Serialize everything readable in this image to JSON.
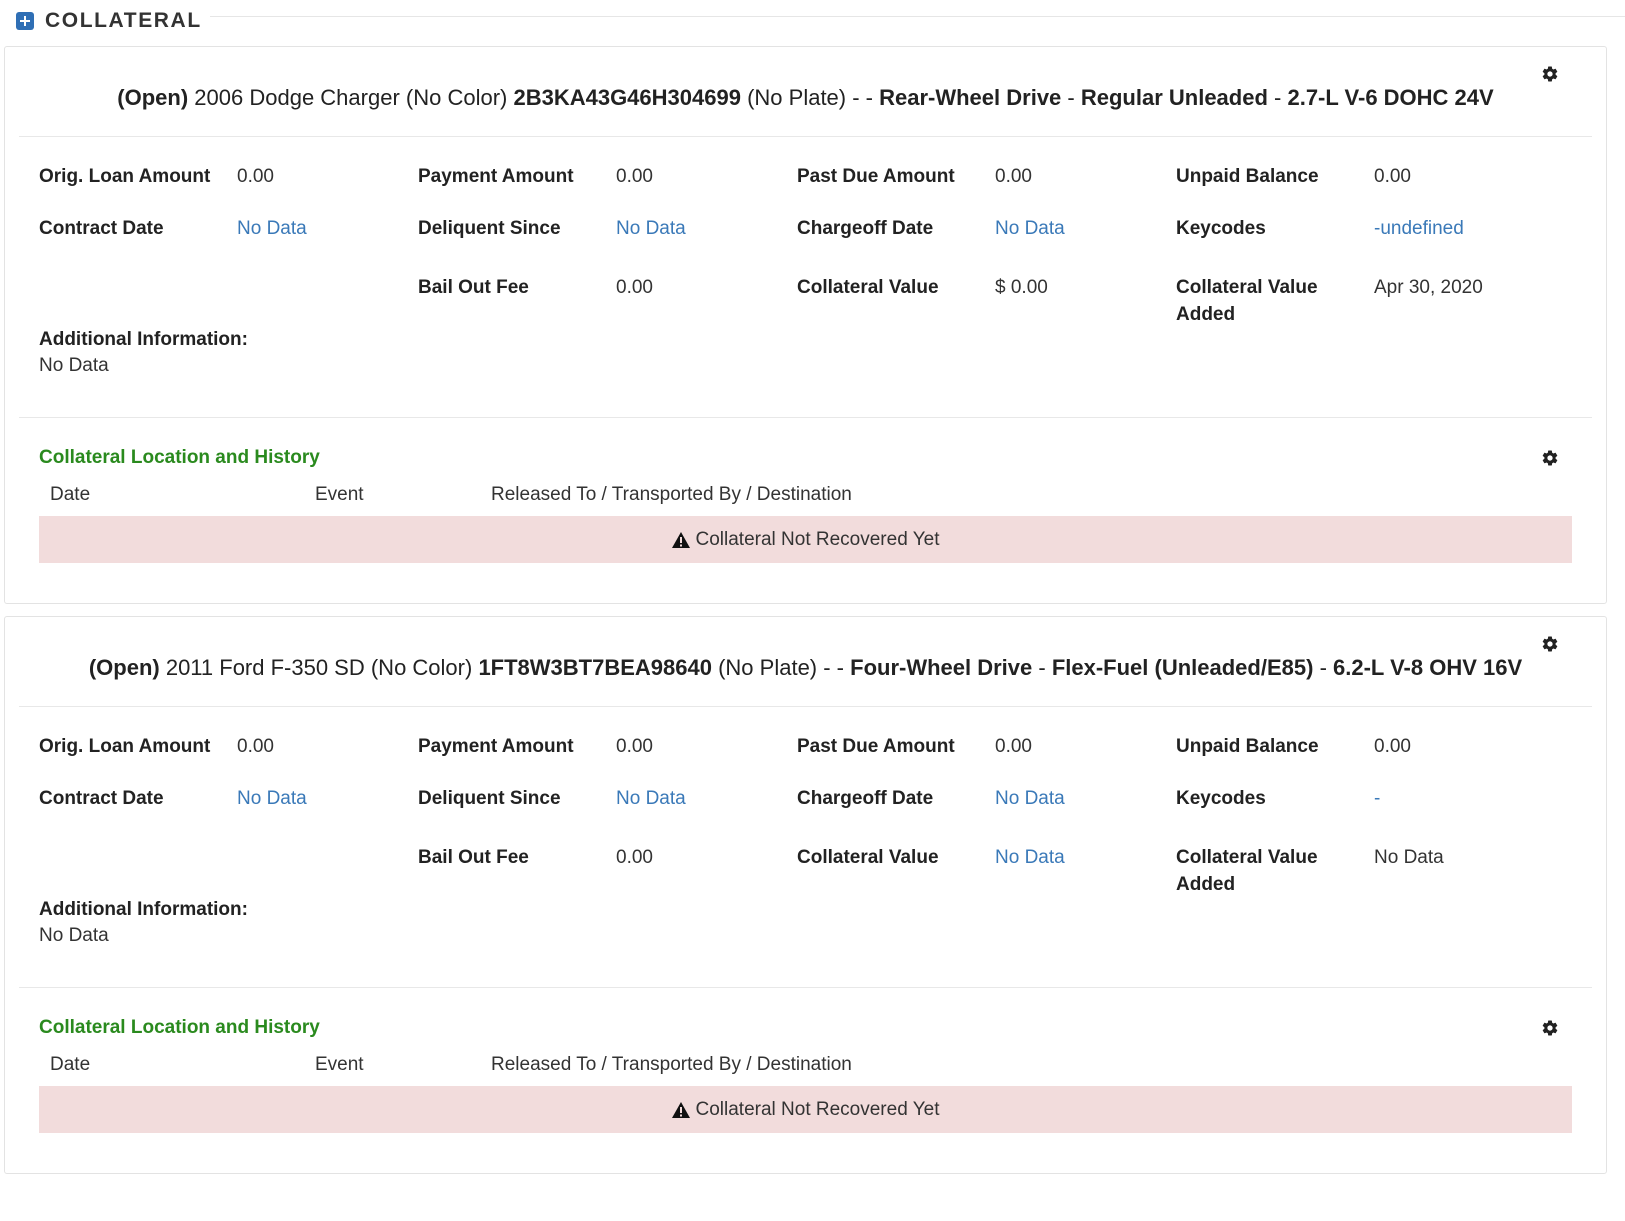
{
  "section": {
    "title": "COLLATERAL"
  },
  "collaterals": [
    {
      "title": {
        "status": "(Open)",
        "vehicle": " 2006 Dodge Charger (No Color) ",
        "vin": "2B3KA43G46H304699",
        "plate": " (No Plate) - - ",
        "drive": "Rear-Wheel Drive",
        "sep1": " - ",
        "fuel": "Regular Unleaded",
        "sep2": " - ",
        "engine": "2.7-L V-6 DOHC 24V"
      },
      "fields": {
        "orig_loan_amount": {
          "label": "Orig. Loan Amount",
          "value": "0.00"
        },
        "payment_amount": {
          "label": "Payment Amount",
          "value": "0.00"
        },
        "past_due_amount": {
          "label": "Past Due Amount",
          "value": "0.00"
        },
        "unpaid_balance": {
          "label": "Unpaid Balance",
          "value": "0.00"
        },
        "contract_date": {
          "label": "Contract Date",
          "value": "No Data"
        },
        "deliquent_since": {
          "label": "Deliquent Since",
          "value": "No Data"
        },
        "chargeoff_date": {
          "label": "Chargeoff Date",
          "value": "No Data"
        },
        "keycodes": {
          "label": "Keycodes",
          "value": "-undefined"
        },
        "bail_out_fee": {
          "label": "Bail Out Fee",
          "value": "0.00"
        },
        "collateral_value": {
          "label": "Collateral Value",
          "value": "$ 0.00"
        },
        "collateral_value_added": {
          "label": "Collateral Value Added",
          "value": "Apr 30, 2020"
        }
      },
      "additional_info": {
        "label": "Additional Information:",
        "value": "No Data"
      },
      "history": {
        "title": "Collateral Location and History",
        "columns": [
          "Date",
          "Event",
          "Released To / Transported By / Destination"
        ],
        "alert": "Collateral Not Recovered Yet"
      }
    },
    {
      "title": {
        "status": "(Open)",
        "vehicle": " 2011 Ford F-350 SD (No Color) ",
        "vin": "1FT8W3BT7BEA98640",
        "plate": " (No Plate) - - ",
        "drive": "Four-Wheel Drive",
        "sep1": " - ",
        "fuel": "Flex-Fuel (Unleaded/E85)",
        "sep2": " - ",
        "engine": "6.2-L V-8 OHV 16V"
      },
      "fields": {
        "orig_loan_amount": {
          "label": "Orig. Loan Amount",
          "value": "0.00"
        },
        "payment_amount": {
          "label": "Payment Amount",
          "value": "0.00"
        },
        "past_due_amount": {
          "label": "Past Due Amount",
          "value": "0.00"
        },
        "unpaid_balance": {
          "label": "Unpaid Balance",
          "value": "0.00"
        },
        "contract_date": {
          "label": "Contract Date",
          "value": "No Data"
        },
        "deliquent_since": {
          "label": "Deliquent Since",
          "value": "No Data"
        },
        "chargeoff_date": {
          "label": "Chargeoff Date",
          "value": "No Data"
        },
        "keycodes": {
          "label": "Keycodes",
          "value": "-"
        },
        "bail_out_fee": {
          "label": "Bail Out Fee",
          "value": "0.00"
        },
        "collateral_value": {
          "label": "Collateral Value",
          "value": "No Data"
        },
        "collateral_value_added": {
          "label": "Collateral Value Added",
          "value": "No Data"
        }
      },
      "additional_info": {
        "label": "Additional Information:",
        "value": "No Data"
      },
      "history": {
        "title": "Collateral Location and History",
        "columns": [
          "Date",
          "Event",
          "Released To / Transported By / Destination"
        ],
        "alert": "Collateral Not Recovered Yet"
      }
    }
  ],
  "icons": {
    "expand": "plus-square-icon",
    "settings": "gear-icon",
    "warning": "warning-triangle-icon"
  },
  "colors": {
    "accent": "#2f6fb5",
    "link": "#3a79b8",
    "history_title": "#2a8a1e",
    "alert_bg": "#f2dcdc"
  }
}
